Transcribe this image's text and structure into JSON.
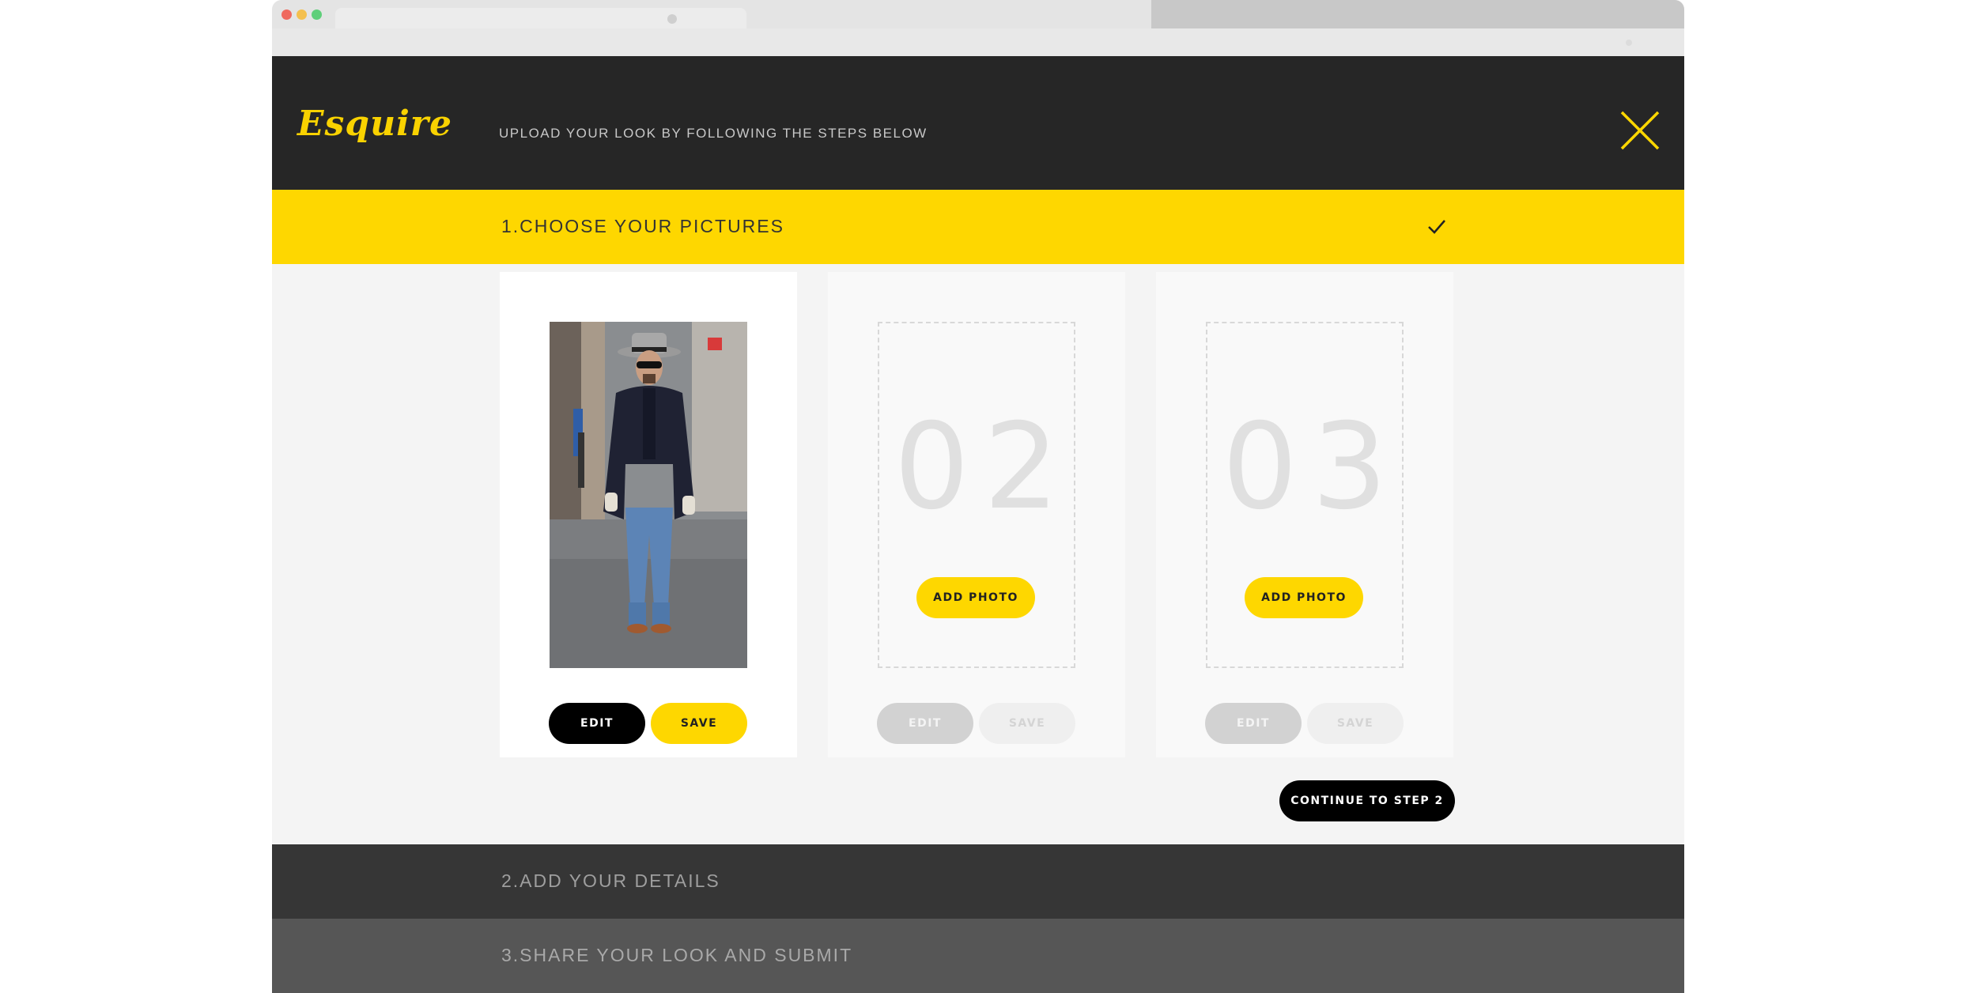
{
  "header": {
    "logo": "Esquire",
    "tagline": "UPLOAD YOUR LOOK BY FOLLOWING THE STEPS BELOW",
    "close_icon": "close-x-icon"
  },
  "steps": [
    {
      "label": "1.CHOOSE YOUR PICTURES",
      "status_icon": "checkmark-icon"
    },
    {
      "label": "2.ADD YOUR DETAILS"
    },
    {
      "label": "3.SHARE YOUR LOOK AND SUBMIT"
    }
  ],
  "cards": [
    {
      "edit_label": "EDIT",
      "save_label": "SAVE"
    },
    {
      "number": "02",
      "add_label": "ADD PHOTO",
      "edit_label": "EDIT",
      "save_label": "SAVE"
    },
    {
      "number": "03",
      "add_label": "ADD PHOTO",
      "edit_label": "EDIT",
      "save_label": "SAVE"
    }
  ],
  "continue_label": "CONTINUE TO STEP 2",
  "colors": {
    "accent": "#fed700",
    "header_bg": "#262626",
    "step2_bg": "#363636",
    "step3_bg": "#565656"
  }
}
